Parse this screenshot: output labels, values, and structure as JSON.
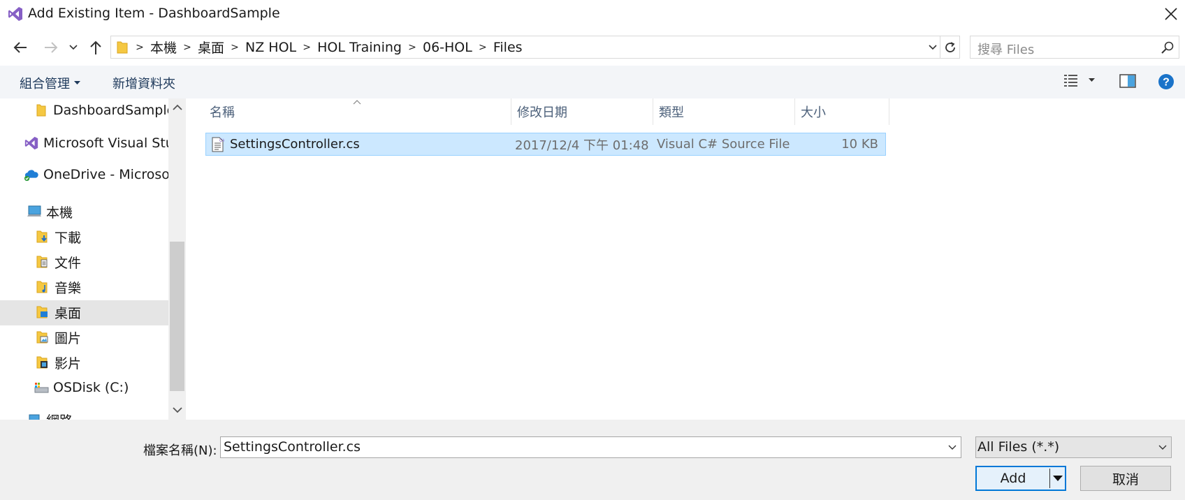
{
  "window": {
    "title": "Add Existing Item - DashboardSample"
  },
  "breadcrumb": [
    "本機",
    "桌面",
    "NZ HOL",
    "HOL Training",
    "06-HOL",
    "Files"
  ],
  "search": {
    "placeholder": "搜尋 Files"
  },
  "toolbar": {
    "organize_label": "組合管理",
    "new_folder_label": "新增資料夾"
  },
  "nav": {
    "items": [
      {
        "label": "DashboardSample",
        "icon": "folder-icon"
      },
      {
        "label": "Microsoft Visual Studio",
        "icon": "visual-studio-icon"
      },
      {
        "label": "OneDrive - Microsoft",
        "icon": "onedrive-icon"
      },
      {
        "label": "本機",
        "icon": "computer-icon"
      },
      {
        "label": "下載",
        "icon": "downloads-folder-icon"
      },
      {
        "label": "文件",
        "icon": "documents-folder-icon"
      },
      {
        "label": "音樂",
        "icon": "music-folder-icon"
      },
      {
        "label": "桌面",
        "icon": "desktop-folder-icon",
        "selected": true
      },
      {
        "label": "圖片",
        "icon": "pictures-folder-icon"
      },
      {
        "label": "影片",
        "icon": "videos-folder-icon"
      },
      {
        "label": "OSDisk (C:)",
        "icon": "drive-icon"
      },
      {
        "label": "網路",
        "icon": "network-icon"
      }
    ]
  },
  "columns": {
    "name": "名稱",
    "date": "修改日期",
    "type": "類型",
    "size": "大小"
  },
  "files": [
    {
      "name": "SettingsController.cs",
      "date": "2017/12/4 下午 01:48",
      "type": "Visual C# Source File",
      "size": "10 KB"
    }
  ],
  "footer": {
    "filename_label": "檔案名稱(N):",
    "filename_value": "SettingsController.cs",
    "filetype_value": "All Files (*.*)",
    "add_label": "Add",
    "cancel_label": "取消"
  },
  "colors": {
    "accent": "#0078d7",
    "selection": "#cce8ff",
    "vs_purple": "#865fc5"
  }
}
